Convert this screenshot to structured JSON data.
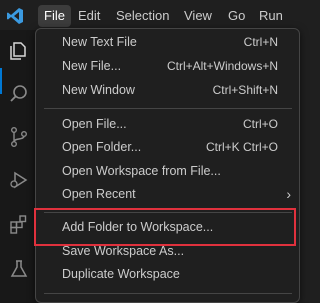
{
  "menubar": {
    "items": [
      "File",
      "Edit",
      "Selection",
      "View",
      "Go",
      "Run"
    ]
  },
  "activitybar": {
    "icons": [
      "files-icon",
      "search-icon",
      "source-control-icon",
      "run-debug-icon",
      "extensions-icon",
      "testing-icon"
    ]
  },
  "file_menu": {
    "items": [
      {
        "label": "New Text File",
        "shortcut": "Ctrl+N"
      },
      {
        "label": "New File...",
        "shortcut": "Ctrl+Alt+Windows+N"
      },
      {
        "label": "New Window",
        "shortcut": "Ctrl+Shift+N"
      },
      {
        "label": "Open File...",
        "shortcut": "Ctrl+O"
      },
      {
        "label": "Open Folder...",
        "shortcut": "Ctrl+K Ctrl+O"
      },
      {
        "label": "Open Workspace from File...",
        "shortcut": ""
      },
      {
        "label": "Open Recent",
        "shortcut": ""
      },
      {
        "label": "Add Folder to Workspace...",
        "shortcut": ""
      },
      {
        "label": "Save Workspace As...",
        "shortcut": ""
      },
      {
        "label": "Duplicate Workspace",
        "shortcut": ""
      }
    ]
  },
  "colors": {
    "accent": "#0078d4",
    "highlight_border": "#e0313d",
    "background": "#1f1f1f"
  }
}
